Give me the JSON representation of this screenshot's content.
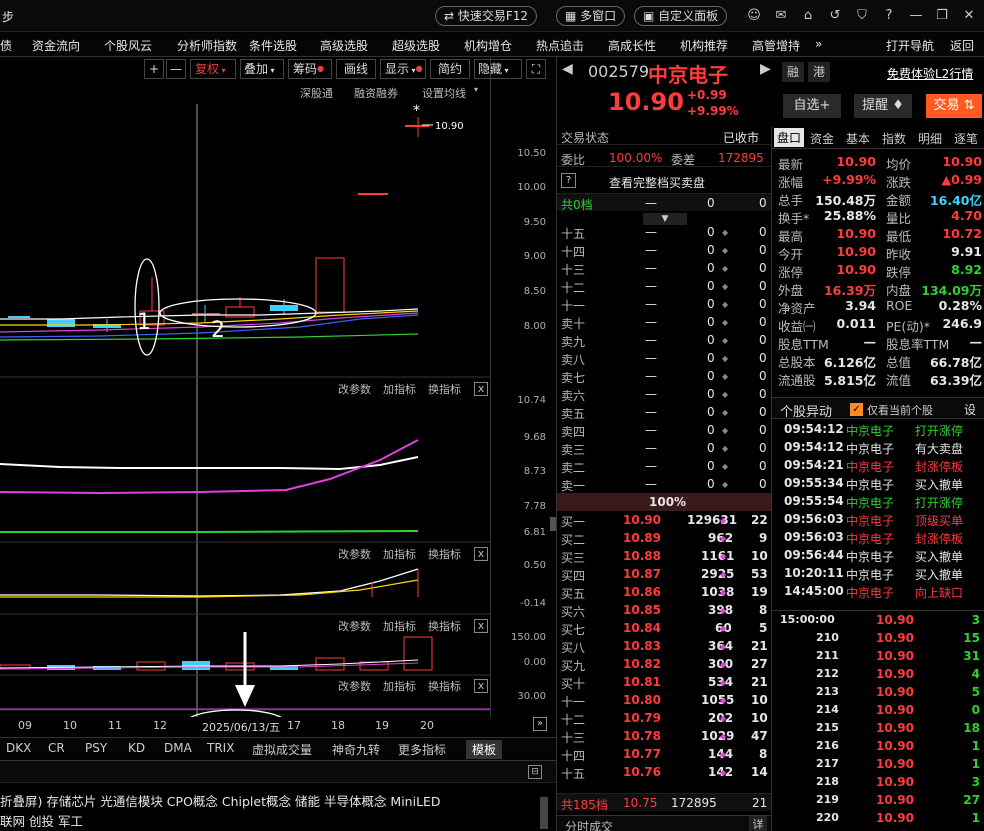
{
  "titlebar": {
    "left_text": "步",
    "quick_trade": "快速交易F12",
    "multi_window": "多窗口",
    "custom_panel": "自定义面板"
  },
  "menu": [
    "资金流向",
    "个股风云",
    "分析师指数",
    "条件选股",
    "高级选股",
    "超级选股",
    "机构增仓",
    "热点追击",
    "高成长性",
    "机构推荐",
    "高管增持",
    "»",
    "打开导航",
    "返回"
  ],
  "menu_partial": "债",
  "chart_toolbar": {
    "plus": "+",
    "minus": "—",
    "restore_rights": "复权",
    "overlay": "叠加",
    "chips": "筹码",
    "draw_line": "画线",
    "display": "显示",
    "simplified": "简约",
    "hide": "隐藏"
  },
  "chart_sub_toolbar": {
    "sh_sz_connect": "深股通",
    "margin": "融资融券",
    "set_ma": "设置均线"
  },
  "price_axis": [
    "10.50",
    "10.00",
    "9.50",
    "9.00",
    "8.50",
    "8.00"
  ],
  "high_label": "10.90",
  "high_mark": "*",
  "annotations": {
    "circle1": "1",
    "circle2": "2"
  },
  "indicator_bar": {
    "edit_params": "改参数",
    "add_indicator": "加指标",
    "swap_indicator": "换指标",
    "close": "x"
  },
  "panel2_axis": [
    "10.74",
    "9.68",
    "8.73",
    "7.78",
    "6.81"
  ],
  "panel3_axis": [
    "0.50",
    "-0.14"
  ],
  "panel4_axis": [
    "150.00",
    "0.00"
  ],
  "panel5_axis": [
    "30.00"
  ],
  "date_axis": [
    "09",
    "10",
    "11",
    "12",
    "2025/06/13/五",
    "17",
    "18",
    "19",
    "20"
  ],
  "indicator_tabs": [
    "DKX",
    "CR",
    "PSY",
    "KD",
    "DMA",
    "TRIX",
    "虚拟成交量",
    "神奇九转",
    "更多指标",
    "模板"
  ],
  "concepts_line1": "折叠屏) 存储芯片 光通信模块 CPO概念 Chiplet概念 储能 半导体概念 MiniLED",
  "concepts_line2": "联网 创投 军工",
  "stock": {
    "code": "002579",
    "name": "中京电子",
    "tag_margin": "融",
    "tag_hk": "港",
    "price": "10.90",
    "change": "+0.99",
    "pct": "+9.99%",
    "l2_trial": "免费体验L2行情",
    "btn_watch": "自选+",
    "btn_alert": "提醒",
    "btn_trade": "交易"
  },
  "order_book": {
    "status_label": "交易状态",
    "status_value": "已收市",
    "ratio_label": "委比",
    "ratio_value": "100.00%",
    "diff_label": "委差",
    "diff_value": "172895",
    "view_full": "查看完整档买卖盘",
    "question": "?",
    "top_count": "共0档",
    "top_dash": "—",
    "top_v1": "0",
    "top_v2": "0",
    "asks": [
      {
        "label": "十五",
        "price": "—",
        "vol": "0",
        "n": "0"
      },
      {
        "label": "十四",
        "price": "—",
        "vol": "0",
        "n": "0"
      },
      {
        "label": "十三",
        "price": "—",
        "vol": "0",
        "n": "0"
      },
      {
        "label": "十二",
        "price": "—",
        "vol": "0",
        "n": "0"
      },
      {
        "label": "十一",
        "price": "—",
        "vol": "0",
        "n": "0"
      },
      {
        "label": "卖十",
        "price": "—",
        "vol": "0",
        "n": "0"
      },
      {
        "label": "卖九",
        "price": "—",
        "vol": "0",
        "n": "0"
      },
      {
        "label": "卖八",
        "price": "—",
        "vol": "0",
        "n": "0"
      },
      {
        "label": "卖七",
        "price": "—",
        "vol": "0",
        "n": "0"
      },
      {
        "label": "卖六",
        "price": "—",
        "vol": "0",
        "n": "0"
      },
      {
        "label": "卖五",
        "price": "—",
        "vol": "0",
        "n": "0"
      },
      {
        "label": "卖四",
        "price": "—",
        "vol": "0",
        "n": "0"
      },
      {
        "label": "卖三",
        "price": "—",
        "vol": "0",
        "n": "0"
      },
      {
        "label": "卖二",
        "price": "—",
        "vol": "0",
        "n": "0"
      },
      {
        "label": "卖一",
        "price": "—",
        "vol": "0",
        "n": "0"
      }
    ],
    "mid_pct": "100%",
    "bids": [
      {
        "label": "买一",
        "price": "10.90",
        "vol": "129631",
        "n": "22"
      },
      {
        "label": "买二",
        "price": "10.89",
        "vol": "962",
        "n": "9"
      },
      {
        "label": "买三",
        "price": "10.88",
        "vol": "1161",
        "n": "10"
      },
      {
        "label": "买四",
        "price": "10.87",
        "vol": "2925",
        "n": "53"
      },
      {
        "label": "买五",
        "price": "10.86",
        "vol": "1038",
        "n": "19"
      },
      {
        "label": "买六",
        "price": "10.85",
        "vol": "398",
        "n": "8"
      },
      {
        "label": "买七",
        "price": "10.84",
        "vol": "60",
        "n": "5"
      },
      {
        "label": "买八",
        "price": "10.83",
        "vol": "364",
        "n": "21"
      },
      {
        "label": "买九",
        "price": "10.82",
        "vol": "300",
        "n": "27"
      },
      {
        "label": "买十",
        "price": "10.81",
        "vol": "534",
        "n": "21"
      },
      {
        "label": "十一",
        "price": "10.80",
        "vol": "1055",
        "n": "10"
      },
      {
        "label": "十二",
        "price": "10.79",
        "vol": "202",
        "n": "10"
      },
      {
        "label": "十三",
        "price": "10.78",
        "vol": "1029",
        "n": "47"
      },
      {
        "label": "十四",
        "price": "10.77",
        "vol": "144",
        "n": "8"
      },
      {
        "label": "十五",
        "price": "10.76",
        "vol": "142",
        "n": "14"
      }
    ],
    "bottom_count": "共185档",
    "bottom_price": "10.75",
    "bottom_vol": "172895",
    "bottom_n": "21",
    "tick_title": "分时成交",
    "tick_more": "详"
  },
  "quote_tabs": [
    "盘口",
    "资金",
    "基本",
    "指数",
    "明细",
    "逐笔"
  ],
  "quote": [
    {
      "l1": "最新",
      "v1": "10.90",
      "c1": "red",
      "l2": "均价",
      "v2": "10.90",
      "c2": "red"
    },
    {
      "l1": "涨幅",
      "v1": "+9.99%",
      "c1": "red",
      "l2": "涨跌",
      "v2": "▲0.99",
      "c2": "red"
    },
    {
      "l1": "总手",
      "v1": "150.48万",
      "c1": "wht",
      "l2": "金额",
      "v2": "16.40亿",
      "c2": "cyan"
    },
    {
      "l1": "换手*",
      "v1": "25.88%",
      "c1": "wht",
      "l2": "量比",
      "v2": "4.70",
      "c2": "red"
    },
    {
      "l1": "最高",
      "v1": "10.90",
      "c1": "red",
      "l2": "最低",
      "v2": "10.72",
      "c2": "red"
    },
    {
      "l1": "今开",
      "v1": "10.90",
      "c1": "red",
      "l2": "昨收",
      "v2": "9.91",
      "c2": "wht"
    },
    {
      "l1": "涨停",
      "v1": "10.90",
      "c1": "red",
      "l2": "跌停",
      "v2": "8.92",
      "c2": "grn"
    },
    {
      "l1": "外盘",
      "v1": "16.39万",
      "c1": "red",
      "l2": "内盘",
      "v2": "134.09万",
      "c2": "grn"
    },
    {
      "l1": "净资产",
      "v1": "3.94",
      "c1": "wht",
      "l2": "ROE",
      "v2": "0.28%",
      "c2": "wht"
    },
    {
      "l1": "收益㈠",
      "v1": "0.011",
      "c1": "wht",
      "l2": "PE(动)*",
      "v2": "246.9",
      "c2": "wht"
    },
    {
      "l1": "股息TTM",
      "v1": "—",
      "c1": "wht",
      "l2": "股息率TTM",
      "v2": "—",
      "c2": "wht"
    },
    {
      "l1": "总股本",
      "v1": "6.126亿",
      "c1": "wht",
      "l2": "总值",
      "v2": "66.78亿",
      "c2": "wht"
    },
    {
      "l1": "流通股",
      "v1": "5.815亿",
      "c1": "wht",
      "l2": "流值",
      "v2": "63.39亿",
      "c2": "wht"
    }
  ],
  "movers": {
    "title": "个股异动",
    "only_current": "仅看当前个股",
    "settings": "设",
    "rows": [
      {
        "time": "09:54:12",
        "name": "中京电子",
        "event": "打开涨停",
        "color": "grn"
      },
      {
        "time": "09:54:12",
        "name": "中京电子",
        "event": "有大卖盘",
        "color": "wht"
      },
      {
        "time": "09:54:21",
        "name": "中京电子",
        "event": "封涨停板",
        "color": "red"
      },
      {
        "time": "09:55:34",
        "name": "中京电子",
        "event": "买入撤单",
        "color": "wht"
      },
      {
        "time": "09:55:54",
        "name": "中京电子",
        "event": "打开涨停",
        "color": "grn"
      },
      {
        "time": "09:56:03",
        "name": "中京电子",
        "event": "顶级买单",
        "color": "red"
      },
      {
        "time": "09:56:03",
        "name": "中京电子",
        "event": "封涨停板",
        "color": "red"
      },
      {
        "time": "09:56:44",
        "name": "中京电子",
        "event": "买入撤单",
        "color": "wht"
      },
      {
        "time": "10:20:11",
        "name": "中京电子",
        "event": "买入撤单",
        "color": "wht"
      },
      {
        "time": "14:45:00",
        "name": "中京电子",
        "event": "向上缺口",
        "color": "red"
      }
    ]
  },
  "ticks": [
    {
      "t": "15:00:00",
      "p": "10.90",
      "v": "3"
    },
    {
      "t": "210",
      "p": "10.90",
      "v": "15"
    },
    {
      "t": "211",
      "p": "10.90",
      "v": "31"
    },
    {
      "t": "212",
      "p": "10.90",
      "v": "4"
    },
    {
      "t": "213",
      "p": "10.90",
      "v": "5"
    },
    {
      "t": "214",
      "p": "10.90",
      "v": "0"
    },
    {
      "t": "215",
      "p": "10.90",
      "v": "18"
    },
    {
      "t": "216",
      "p": "10.90",
      "v": "1"
    },
    {
      "t": "217",
      "p": "10.90",
      "v": "1"
    },
    {
      "t": "218",
      "p": "10.90",
      "v": "3"
    },
    {
      "t": "219",
      "p": "10.90",
      "v": "27"
    },
    {
      "t": "220",
      "p": "10.90",
      "v": "1"
    }
  ]
}
